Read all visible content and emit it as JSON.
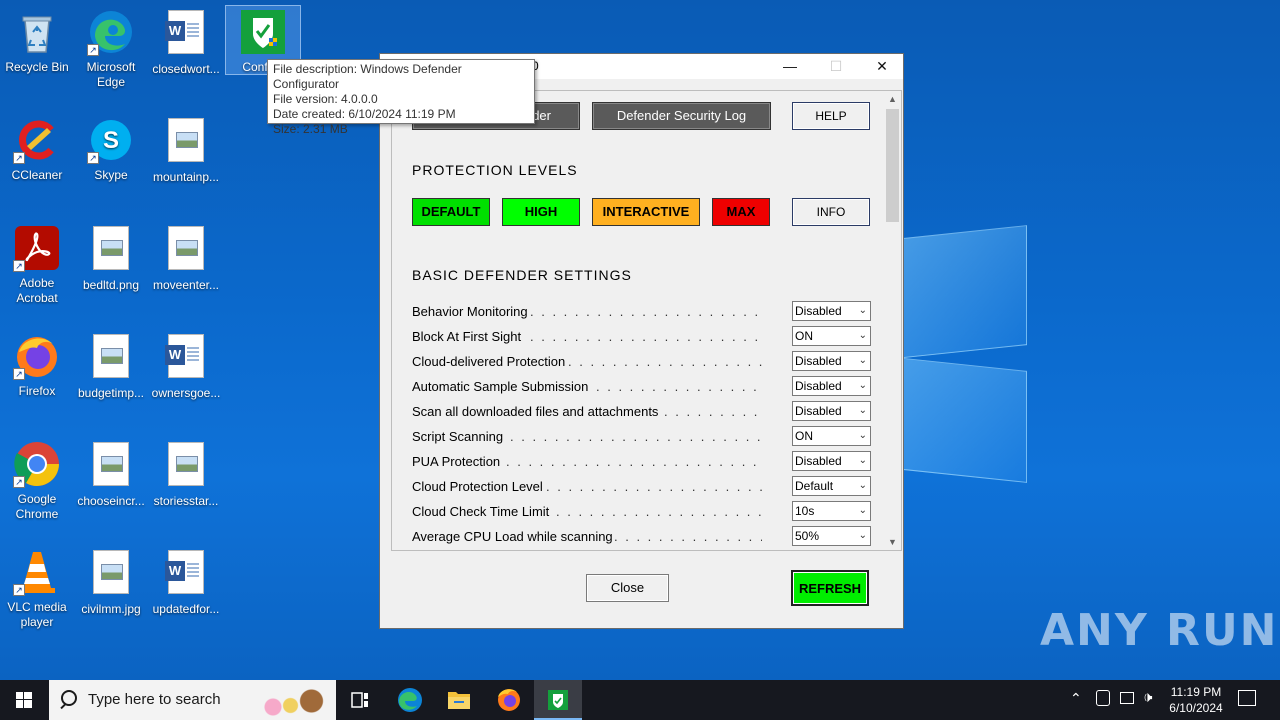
{
  "desktop": {
    "icons": [
      {
        "label": "Recycle Bin"
      },
      {
        "label": "Microsoft Edge"
      },
      {
        "label": "closedwort..."
      },
      {
        "label": "Configu"
      },
      {
        "label": "CCleaner"
      },
      {
        "label": "Skype"
      },
      {
        "label": "mountainp..."
      },
      {
        "label": "Adobe Acrobat"
      },
      {
        "label": "bedltd.png"
      },
      {
        "label": "moveenter..."
      },
      {
        "label": "Firefox"
      },
      {
        "label": "budgetimp..."
      },
      {
        "label": "ownersgoe..."
      },
      {
        "label": "Google Chrome"
      },
      {
        "label": "chooseincr..."
      },
      {
        "label": "storiesstar..."
      },
      {
        "label": "VLC media player"
      },
      {
        "label": "civilmm.jpg"
      },
      {
        "label": "updatedfor..."
      }
    ],
    "watermark": "ANY RUN"
  },
  "tooltip": {
    "line1": "File description: Windows Defender Configurator",
    "line2": "File version: 4.0.0.0",
    "line3": "Date created: 6/10/2024 11:19 PM",
    "line4": "Size: 2.31 MB"
  },
  "window": {
    "title": "0",
    "top_buttons": {
      "left_partial": "der",
      "security_log": "Defender Security Log",
      "help": "HELP"
    },
    "protection_levels": {
      "heading": "PROTECTION LEVELS",
      "buttons": [
        {
          "label": "DEFAULT",
          "color": "#00e000"
        },
        {
          "label": "HIGH",
          "color": "#00ff00"
        },
        {
          "label": "INTERACTIVE",
          "color": "#ffb020"
        },
        {
          "label": "MAX",
          "color": "#ee0000"
        }
      ],
      "info": "INFO"
    },
    "basic_settings": {
      "heading": "BASIC DEFENDER SETTINGS",
      "items": [
        {
          "name": "Behavior Monitoring",
          "value": "Disabled"
        },
        {
          "name": "Block At First Sight",
          "value": "ON"
        },
        {
          "name": "Cloud-delivered Protection",
          "value": "Disabled"
        },
        {
          "name": "Automatic Sample Submission",
          "value": "Disabled"
        },
        {
          "name": "Scan all downloaded files and attachments",
          "value": "Disabled"
        },
        {
          "name": "Script Scanning",
          "value": "ON"
        },
        {
          "name": "PUA Protection",
          "value": "Disabled"
        },
        {
          "name": "Cloud Protection Level",
          "value": "Default"
        },
        {
          "name": "Cloud Check Time Limit",
          "value": "10s"
        },
        {
          "name": "Average CPU Load while scanning",
          "value": "50%"
        }
      ]
    },
    "close_label": "Close",
    "refresh_label": "REFRESH",
    "refresh_color": "#00ee00"
  },
  "taskbar": {
    "search_placeholder": "Type here to search",
    "time": "11:19 PM",
    "date": "6/10/2024"
  }
}
